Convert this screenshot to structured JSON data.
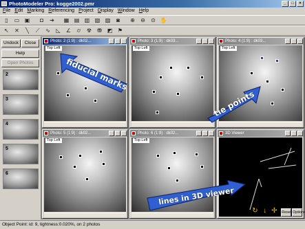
{
  "window": {
    "title": "PhotoModeler Pro: kogge2002.pmr"
  },
  "menu": [
    "File",
    "Edit",
    "Marking",
    "Referencing",
    "Project",
    "Display",
    "Window",
    "Help"
  ],
  "left_panel": {
    "undock_label": "Undock",
    "close_label": "Close",
    "help_label": "Help",
    "open_photos_label": "Open Photos",
    "thumbnails": [
      "2",
      "3",
      "4",
      "5",
      "6"
    ]
  },
  "photo_windows": [
    {
      "title": "Photo: 2 (1:9) : dk02...",
      "corner_label": "Top Left"
    },
    {
      "title": "Photo: 3 (1:9) : dk03...",
      "corner_label": "Top Left"
    },
    {
      "title": "Photo: 4 (1:9) : dk03...",
      "corner_label": "Top Left"
    },
    {
      "title": "Photo: 5 (1:9) : dk02...",
      "corner_label": "Top Left"
    },
    {
      "title": "Photo: 6 (1:9) : dk02...",
      "corner_label": "Top Left"
    }
  ],
  "viewer3d": {
    "title": "3D Viewer",
    "reset_label": "Reset",
    "options_label": "Options"
  },
  "callouts": {
    "fiducial": "fiducial marks",
    "tie": "tie points",
    "lines": "lines in 3D viewer"
  },
  "status": {
    "text": "Object Point:  id: 9,  tightness:0.020%,  on 2 photos"
  },
  "colors": {
    "callout_fill": "#2f5fd0",
    "callout_text": "#ffffff",
    "active_title": "#0a246a",
    "marker_blue": "#3030ff"
  },
  "icons": [
    "new-icon",
    "open-icon",
    "save-icon",
    "print-icon",
    "zoom-in-icon",
    "zoom-out-icon",
    "select-icon",
    "mark-point-icon",
    "line-icon",
    "curve-icon",
    "cylinder-icon",
    "surface-icon"
  ]
}
